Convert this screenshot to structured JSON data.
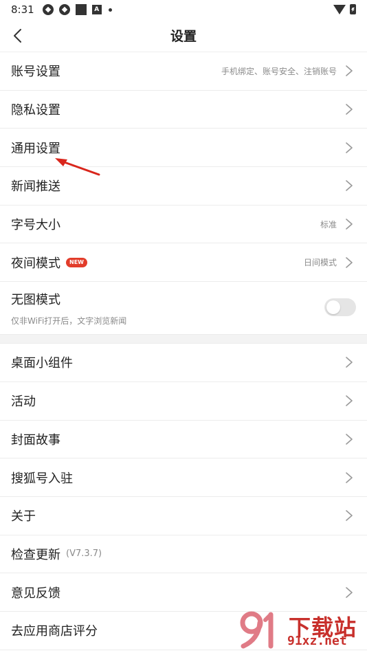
{
  "status_bar": {
    "time": "8:31",
    "left_icons": [
      "app-circle-icon",
      "app-circle-icon",
      "square-app-icon",
      "a-app-icon",
      "dot-icon"
    ],
    "right_icons": [
      "wifi-icon",
      "battery-charging-icon"
    ]
  },
  "header": {
    "title": "设置",
    "back_icon": "chevron-left-icon"
  },
  "section1": [
    {
      "label": "账号设置",
      "sub": "手机绑定、账号安全、注销账号"
    },
    {
      "label": "隐私设置",
      "sub": ""
    },
    {
      "label": "通用设置",
      "sub": ""
    },
    {
      "label": "新闻推送",
      "sub": ""
    },
    {
      "label": "字号大小",
      "sub": "标准"
    },
    {
      "label": "夜间模式",
      "badge": "NEW",
      "sub": "日间模式"
    }
  ],
  "no_image_mode": {
    "label": "无图模式",
    "desc": "仅非WiFi打开后，文字浏览新闻",
    "enabled": false
  },
  "section2": [
    {
      "label": "桌面小组件"
    },
    {
      "label": "活动"
    },
    {
      "label": "封面故事"
    },
    {
      "label": "搜狐号入驻"
    },
    {
      "label": "关于"
    },
    {
      "label": "检查更新",
      "version": "(V7.3.7)"
    },
    {
      "label": "意见反馈"
    },
    {
      "label": "去应用商店评分"
    }
  ],
  "watermark": {
    "title": "下载站",
    "url": "91xz.net"
  },
  "colors": {
    "accent_red": "#e23c2a",
    "arrow_red": "#d9261c",
    "text_primary": "#222222",
    "text_secondary": "#8a8a8a",
    "divider": "#ececec"
  }
}
